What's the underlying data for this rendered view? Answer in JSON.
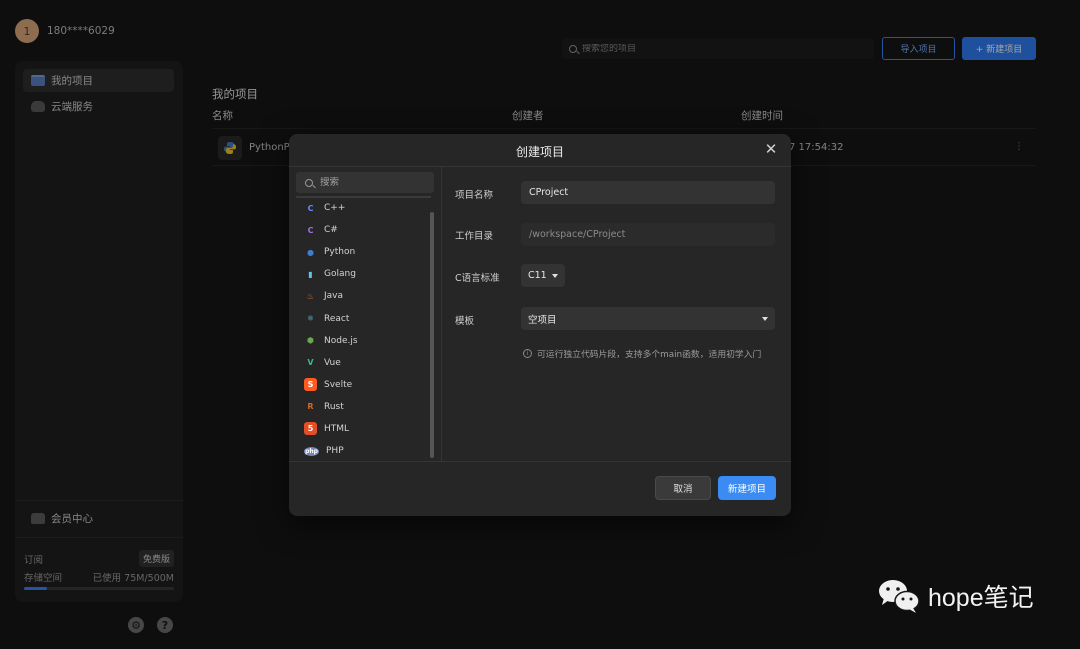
{
  "user": {
    "avatar_initial": "1",
    "name": "180****6029"
  },
  "sidebar": {
    "items": [
      {
        "label": "我的项目",
        "icon": "folder-icon",
        "active": true
      },
      {
        "label": "云端服务",
        "icon": "cloud-icon",
        "active": false
      }
    ],
    "member_center": "会员中心",
    "subscription_label": "订阅",
    "subscription_badge": "免费版",
    "storage_label": "存储空间",
    "storage_used": "已使用 75M/500M",
    "storage_fraction": 0.15
  },
  "header": {
    "search_placeholder": "搜索您的项目",
    "import_button": "导入项目",
    "new_button": "+ 新建项目"
  },
  "projects": {
    "title": "我的项目",
    "columns": [
      "名称",
      "创建者",
      "创建时间"
    ],
    "rows": [
      {
        "name": "PythonPr",
        "time": "7 17:54:32",
        "more": "⋮"
      }
    ]
  },
  "modal": {
    "title": "创建项目",
    "close": "✕",
    "search_placeholder": "搜索",
    "languages": [
      {
        "label": "C++",
        "icon": "cpp-icon",
        "color": "#6b8cf7"
      },
      {
        "label": "C#",
        "icon": "csharp-icon",
        "color": "#a070e0"
      },
      {
        "label": "Python",
        "icon": "python-icon",
        "color": "#3f7fc9"
      },
      {
        "label": "Golang",
        "icon": "golang-icon",
        "color": "#5ec8e5"
      },
      {
        "label": "Java",
        "icon": "java-icon",
        "color": "#e07b39"
      },
      {
        "label": "React",
        "icon": "react-icon",
        "color": "#61dafb"
      },
      {
        "label": "Node.js",
        "icon": "nodejs-icon",
        "color": "#6aa84f"
      },
      {
        "label": "Vue",
        "icon": "vue-icon",
        "color": "#41b883"
      },
      {
        "label": "Svelte",
        "icon": "svelte-icon",
        "color": "#ff5a1f"
      },
      {
        "label": "Rust",
        "icon": "rust-icon",
        "color": "#d0672d"
      },
      {
        "label": "HTML",
        "icon": "html-icon",
        "color": "#e44d26"
      },
      {
        "label": "PHP",
        "icon": "php-icon",
        "color": "#7a86b8"
      }
    ],
    "fields": {
      "name_label": "项目名称",
      "name_value": "CProject",
      "dir_label": "工作目录",
      "dir_value": "/workspace/CProject",
      "std_label": "C语言标准",
      "std_value": "C11",
      "template_label": "模板",
      "template_value": "空项目",
      "hint": "可运行独立代码片段，支持多个main函数，适用初学入门"
    },
    "cancel_button": "取消",
    "create_button": "新建项目"
  },
  "watermark": {
    "text": "hope笔记"
  }
}
